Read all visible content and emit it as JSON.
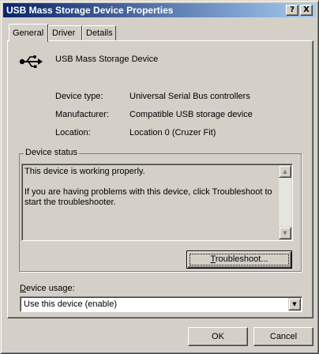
{
  "window": {
    "title": "USB Mass Storage Device Properties",
    "help_glyph": "?",
    "close_glyph": "X"
  },
  "tabs": [
    {
      "label": "General",
      "active": true
    },
    {
      "label": "Driver",
      "active": false
    },
    {
      "label": "Details",
      "active": false
    }
  ],
  "device": {
    "icon": "usb-icon",
    "name": "USB Mass Storage Device",
    "properties": [
      {
        "label": "Device type:",
        "value": "Universal Serial Bus controllers"
      },
      {
        "label": "Manufacturer:",
        "value": "Compatible USB storage device"
      },
      {
        "label": "Location:",
        "value": "Location 0 (Cruzer Fit)"
      }
    ]
  },
  "status": {
    "group_label": "Device status",
    "line1": "This device is working properly.",
    "line2": "If you are having problems with this device, click Troubleshoot to start the troubleshooter.",
    "troubleshoot_first": "T",
    "troubleshoot_rest": "roubleshoot..."
  },
  "usage": {
    "label_first": "D",
    "label_rest": "evice usage:",
    "selected": "Use this device (enable)"
  },
  "buttons": {
    "ok": "OK",
    "cancel": "Cancel"
  }
}
